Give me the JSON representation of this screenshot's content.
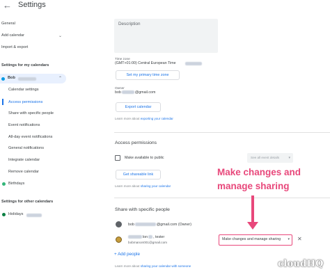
{
  "header": {
    "back_icon": "arrow-back-icon",
    "title": "Settings"
  },
  "sidebar": {
    "top_items": [
      "General",
      "Add calendar",
      "Import & export"
    ],
    "my_calendars_heading": "Settings for my calendars",
    "user_name": "Bob",
    "sub_items": [
      "Calendar settings",
      "Access permissions",
      "Share with specific people",
      "Event notifications",
      "All-day event notifications",
      "General notifications",
      "Integrate calendar",
      "Remove calendar"
    ],
    "birthdays": "Birthdays",
    "other_calendars_heading": "Settings for other calendars",
    "holidays": "Holidays"
  },
  "main": {
    "description_label": "Description",
    "time_zone_label": "Time zone",
    "time_zone_value": "(GMT+01:00) Central European Time",
    "time_zone_button": "Set my primary time zone",
    "owner_label": "Owner",
    "owner_email_suffix": "@gmail.com",
    "export_button": "Export calendar",
    "export_learn_prefix": "Learn more about",
    "export_learn_link": "exporting your calendar",
    "access_heading": "Access permissions",
    "make_public_label": "Make available to public",
    "public_select_value": "See all event details",
    "shareable_link_button": "Get shareable link",
    "sharing_learn_prefix": "Learn more about",
    "sharing_learn_link": "sharing your calendar",
    "share_heading": "Share with specific people",
    "person1_name": "bob",
    "person1_suffix": "@gmail.com (Owner)",
    "person2_name_fragment": "lon",
    "person2_name_end": ", tester",
    "person2_email": "bobmanon001@gmail.com",
    "permission_value": "Make changes and manage sharing",
    "remove_icon": "close-icon",
    "add_people": "Add people",
    "people_learn_prefix": "Learn more about",
    "people_learn_link": "sharing your calendar with someone"
  },
  "annotation": {
    "callout_line1": "Make changes and",
    "callout_line2": "manage sharing"
  },
  "watermark": "cloudHQ",
  "colors": {
    "accent": "#1a73e8",
    "highlight": "#e8487b",
    "selected_bg": "#e8f0fe",
    "user_dot": "#039be5",
    "birthday_dot": "#33b679",
    "holiday_dot": "#0b8043"
  }
}
